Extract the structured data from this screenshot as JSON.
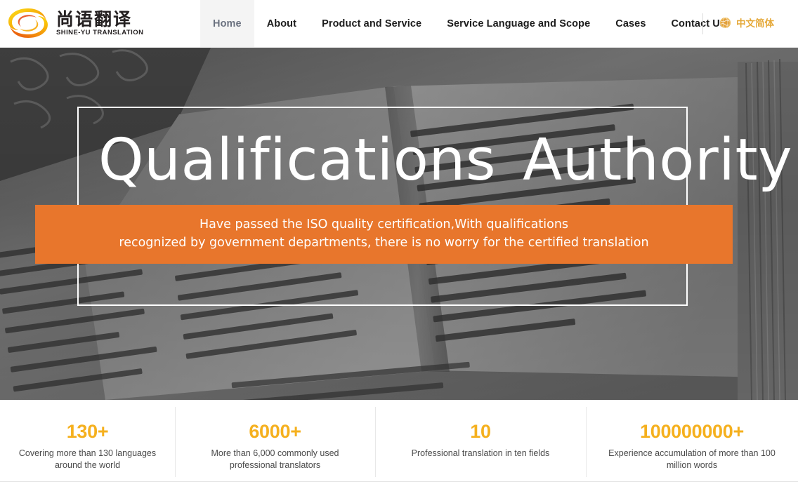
{
  "header": {
    "logo": {
      "icon": "swirl-logo-icon",
      "chinese_name": "尚语翻译",
      "english_name": "SHINE-YU TRANSLATION",
      "colors": {
        "swirl_start": "#F7D417",
        "swirl_end": "#EC6608"
      }
    },
    "nav_items": [
      {
        "label": "Home",
        "active": true
      },
      {
        "label": "About",
        "active": false
      },
      {
        "label": "Product and Service",
        "active": false
      },
      {
        "label": "Service Language and Scope",
        "active": false
      },
      {
        "label": "Cases",
        "active": false
      },
      {
        "label": "Contact Us",
        "active": false
      }
    ],
    "language_switch": {
      "icon": "globe-icon",
      "label": "中文简体",
      "color": "#E5A93A"
    }
  },
  "hero": {
    "title_part_1": "Qualifications",
    "title_part_2": "Authority",
    "banner": {
      "line_1": "Have passed the ISO quality certification,With qualifications",
      "line_2": "recognized by government departments, there is no worry for the certified translation",
      "background_color": "#E8762C"
    },
    "background_image_description": "open book with printed Polish text, grayscale"
  },
  "stats": {
    "accent_color": "#F5B01E",
    "items": [
      {
        "value": "130+",
        "label": "Covering more than 130 languages around the world"
      },
      {
        "value": "6000+",
        "label": "More than 6,000 commonly used professional translators"
      },
      {
        "value": "10",
        "label": "Professional translation in ten fields"
      },
      {
        "value": "100000000+",
        "label": "Experience accumulation of more than 100 million words"
      }
    ]
  }
}
